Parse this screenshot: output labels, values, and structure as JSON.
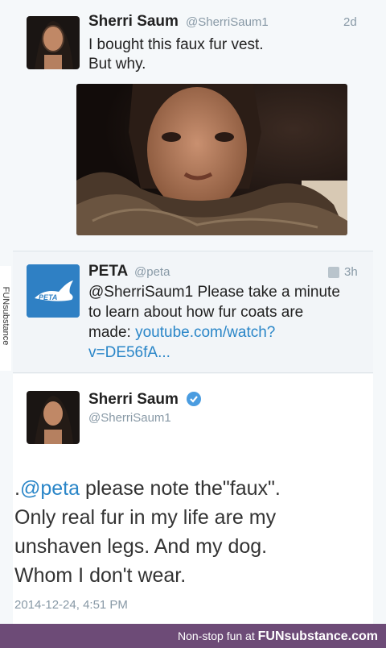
{
  "tweet1": {
    "name": "Sherri Saum",
    "handle": "@SherriSaum1",
    "age": "2d",
    "line1": "I bought this faux fur vest.",
    "line2": "But why."
  },
  "tweet2": {
    "name": "PETA",
    "handle": "@peta",
    "age": "3h",
    "logo_text": "PETA",
    "line1": "@SherriSaum1 Please take a minute",
    "line2": "to learn about how fur coats are",
    "line3_prefix": "made: ",
    "line3_link": "youtube.com/watch?",
    "line4_link": "v=DE56fA..."
  },
  "tweet3": {
    "name": "Sherri Saum",
    "handle": "@SherriSaum1",
    "text_prefix": ".",
    "text_mention": "@peta",
    "text_line1_rest": " please note the\"faux\".",
    "text_line2": "Only real fur in my life are my",
    "text_line3": "unshaven legs. And my dog.",
    "text_line4": "Whom I don't wear.",
    "timestamp": "2014-12-24, 4:51 PM"
  },
  "footer": {
    "tagline": "Non-stop fun at ",
    "brand": "FUNsubstance.com"
  },
  "side_tab": "FUNsubstance",
  "colors": {
    "link": "#2a86c8",
    "footer_bg": "#6d4b77",
    "peta_blue": "#2f80c4"
  }
}
